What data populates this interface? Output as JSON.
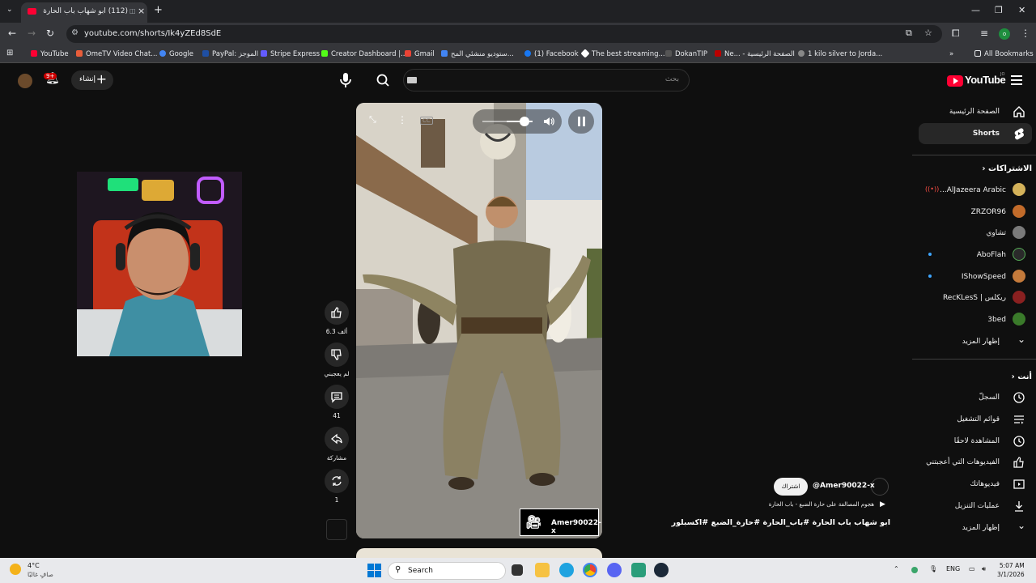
{
  "browser": {
    "tab_title": "(112) ابو شهاب باب الحارة",
    "url": "youtube.com/shorts/Ik4yZEd8SdE",
    "bookmarks": [
      "YouTube",
      "OmeTV Video Chat...",
      "Google",
      "PayPal: الموجز",
      "Stripe Express",
      "Creator Dashboard |...",
      "Gmail",
      "ستوديو منشئي المح...",
      "(1) Facebook",
      "The best streaming...",
      "DokanTIP",
      "Ne... - الصفحة الرئيسية",
      "1 kilo silver to Jorda..."
    ],
    "all_bookmarks": "All Bookmarks"
  },
  "header": {
    "search_placeholder": "بحث",
    "create_label": "إنشاء",
    "notif_count": "9+",
    "logo_text": "YouTube",
    "logo_country": "JO"
  },
  "sidebar": {
    "home": "الصفحة الرئيسية",
    "shorts": "Shorts",
    "subscriptions_header": "الاشتراكات",
    "channels": [
      {
        "name": "AlJazeera Arabic...",
        "color": "#d4b25a"
      },
      {
        "name": "ZRZOR96",
        "color": "#c26b2a"
      },
      {
        "name": "تشاوي",
        "color": "#7a7a7a"
      },
      {
        "name": "AboFlah",
        "color": "#2a2a2a"
      },
      {
        "name": "IShowSpeed",
        "color": "#c47a3b"
      },
      {
        "name": "ريكلس | RecKLesS",
        "color": "#8a2020"
      },
      {
        "name": "3bed",
        "color": "#3a7a2a"
      }
    ],
    "show_more_1": "إظهار المزيد",
    "you_header": "أنت",
    "you_items": [
      "السجلّ",
      "قوائم التشغيل",
      "المشاهدة لاحقًا",
      "الفيديوهات التي أعجبتني",
      "فيديوهاتك",
      "عمليات التنزيل",
      "إظهار المزيد"
    ]
  },
  "short": {
    "likes": "6.3 ألف",
    "dislike_label": "لم يعجبني",
    "comments": "41",
    "share_label": "مشاركة",
    "remix_count": "1",
    "watermark": "Amer90022-x",
    "channel": "@Amer90022-x",
    "subscribe": "اشتراك",
    "sound": "هجوم المصالفة على حارة الضبع - باب الحارة",
    "title": "ابو شهاب باب الحارة #باب_الحارة #حارة_الضبع #اكسبلور"
  },
  "taskbar": {
    "temp": "4°C",
    "weather_desc": "صافٍ غالبًا",
    "search": "Search",
    "lang": "ENG",
    "time": "5:07 AM",
    "date": "3/1/2026"
  }
}
